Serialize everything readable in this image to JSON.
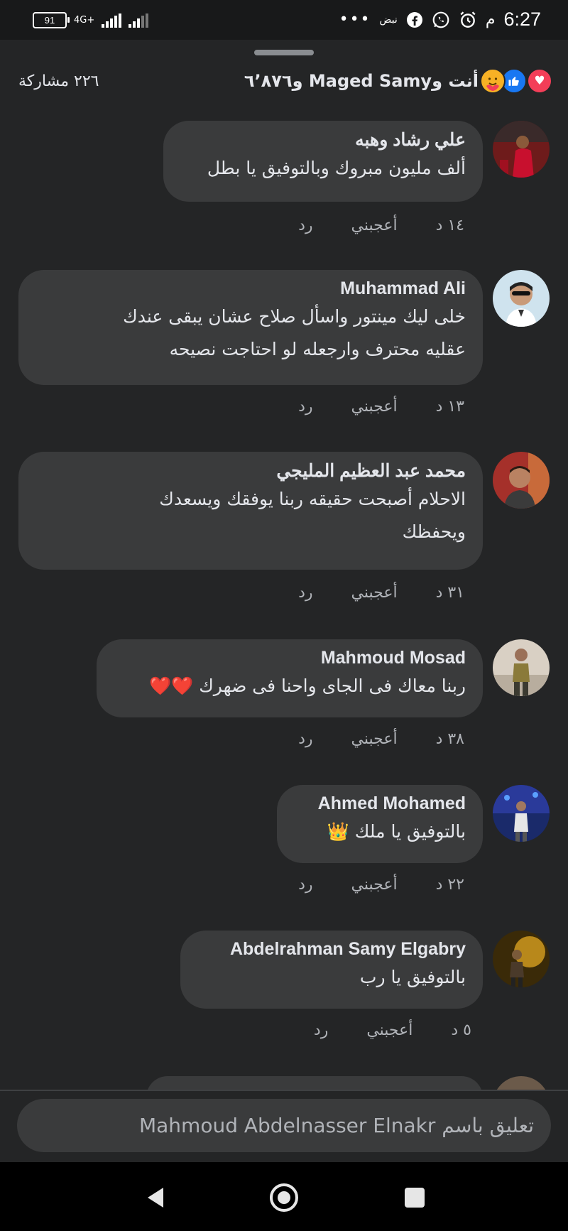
{
  "statusbar": {
    "time": "6:27",
    "ampm": "م",
    "label": "نبض",
    "dots": "•••",
    "battery": "91",
    "network": "4G+"
  },
  "reactions": {
    "summary": "أنت وMaged Samy و٦٬٨٧٦",
    "shares": "٢٢٦ مشاركة"
  },
  "comments": [
    {
      "author": "علي رشاد وهبه",
      "text": [
        "ألف مليون مبروك وبالتوفيق يا بطل"
      ],
      "time": "١٤ د",
      "like": "أعجبني",
      "reply": "رد"
    },
    {
      "author": "Muhammad Ali",
      "text": [
        "خلى ليك مينتور واسأل صلاح عشان يبقى عندك",
        "عقليه محترف وارجعله لو احتاجت نصيحه"
      ],
      "time": "١٣ د",
      "like": "أعجبني",
      "reply": "رد"
    },
    {
      "author": "محمد عبد العظيم المليجي",
      "text": [
        "الاحلام أصبحت حقيقه ربنا يوفقك ويسعدك",
        "ويحفظك"
      ],
      "time": "٣١ د",
      "like": "أعجبني",
      "reply": "رد"
    },
    {
      "author": "Mahmoud Mosad",
      "text": [
        "ربنا معاك فى الجاى واحنا فى ضهرك ❤️❤️"
      ],
      "time": "٣٨ د",
      "like": "أعجبني",
      "reply": "رد"
    },
    {
      "author": "Ahmed Mohamed",
      "text": [
        "بالتوفيق يا ملك 👑"
      ],
      "time": "٢٢ د",
      "like": "أعجبني",
      "reply": "رد"
    },
    {
      "author": "Abdelrahman Samy Elgabry",
      "text": [
        "بالتوفيق يا رب"
      ],
      "time": "٥ د",
      "like": "أعجبني",
      "reply": "رد"
    }
  ],
  "composer": {
    "placeholder": "تعليق باسم Mahmoud Abdelnasser Elnakr"
  },
  "colors": {
    "background": "#242526",
    "bubble": "#3a3b3c",
    "love": "#f33e58",
    "like": "#1877f2"
  }
}
